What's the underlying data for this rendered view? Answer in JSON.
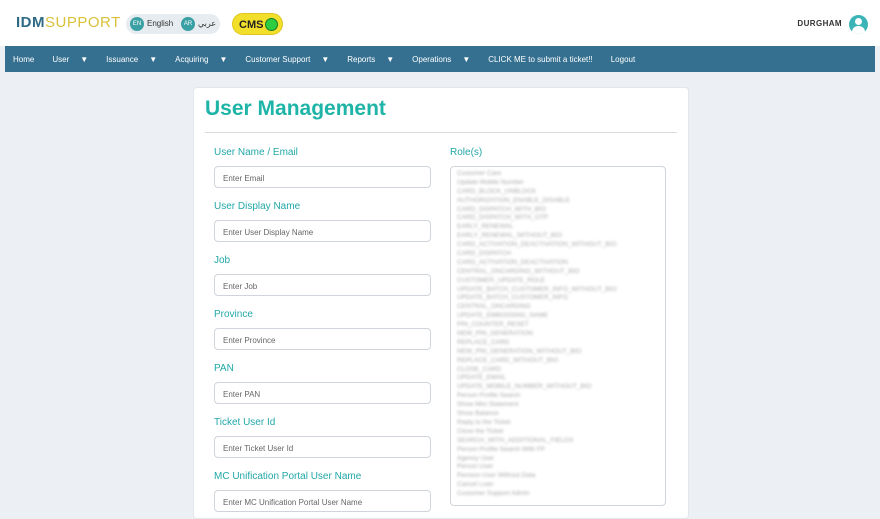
{
  "header": {
    "logo_part1": "IDM",
    "logo_part2": "SUPPORT",
    "lang_en_code": "EN",
    "lang_en_label": "English",
    "lang_ar_code": "AR",
    "lang_ar_label": "عربي",
    "cms_label": "CMS",
    "username": "DURGHAM"
  },
  "nav": {
    "items": [
      {
        "label": "Home",
        "dropdown": false
      },
      {
        "label": "User",
        "dropdown": true
      },
      {
        "label": "Issuance",
        "dropdown": true
      },
      {
        "label": "Acquiring",
        "dropdown": true
      },
      {
        "label": "Customer Support",
        "dropdown": true
      },
      {
        "label": "Reports",
        "dropdown": true
      },
      {
        "label": "Operations",
        "dropdown": true
      },
      {
        "label": "CLICK ME to submit a ticket!!",
        "dropdown": false
      },
      {
        "label": "Logout",
        "dropdown": false
      }
    ]
  },
  "form": {
    "title": "User Management",
    "fields": [
      {
        "label": "User Name / Email",
        "placeholder": "Enter Email"
      },
      {
        "label": "User Display Name",
        "placeholder": "Enter User Display Name"
      },
      {
        "label": "Job",
        "placeholder": "Enter Job"
      },
      {
        "label": "Province",
        "placeholder": "Enter Province"
      },
      {
        "label": "PAN",
        "placeholder": "Enter PAN"
      },
      {
        "label": "Ticket User Id",
        "placeholder": "Enter Ticket User Id"
      },
      {
        "label": "MC Unification Portal User Name",
        "placeholder": "Enter MC Unification Portal User Name"
      }
    ],
    "roles_label": "Role(s)",
    "roles": [
      "Customer Care",
      "Update Mobile Number",
      "CARD_BLOCK_UNBLOCK",
      "AUTHORIZATION_ENABLE_DISABLE",
      "CARD_DISPATCH_WITH_BIO",
      "CARD_DISPATCH_WITH_OTP",
      "EARLY_RENEWAL",
      "EARLY_RENEWAL_WITHOUT_BIO",
      "CARD_ACTIVATION_DEACTIVATION_WITHOUT_BIO",
      "CARD_DISPATCH",
      "CARD_ACTIVATION_DEACTIVATION",
      "CENTRAL_ONCARDING_WITHOUT_BIO",
      "CUSTOMER_UPDATE_ROLE",
      "UPDATE_BATCH_CUSTOMER_INFO_WITHOUT_BIO",
      "UPDATE_BATCH_CUSTOMER_INFO",
      "CENTRAL_ONCARDING",
      "UPDATE_EMBOSSING_NAME",
      "PIN_COUNTER_RESET",
      "NEW_PIN_GENERATION",
      "REPLACE_CARD",
      "NEW_PIN_GENERATION_WITHOUT_BIO",
      "REPLACE_CARD_WITHOUT_BIO",
      "CLOSE_CARD",
      "UPDATE_EMAIL",
      "UPDATE_MOBILE_NUMBER_WITHOUT_BIO",
      "Person Profile Search",
      "Show Mini Statement",
      "Show Balance",
      "Reply to the Ticket",
      "Close the Ticket",
      "SEARCH_WITH_ADDITIONAL_FIELDS",
      "Person Profile Search With FP",
      "Agency User",
      "Person User",
      "Pension User Without Data",
      "Cancel Loan",
      "Customer Support Admin"
    ]
  }
}
